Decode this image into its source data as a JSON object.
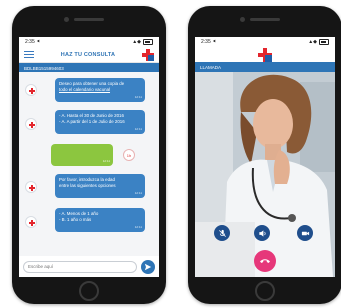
{
  "colors": {
    "brand_blue": "#2e75b6",
    "brand_red": "#e3262d",
    "bubble_blue": "#3b82c4",
    "bubble_green": "#8cc63f",
    "hangup_pink": "#e6377a"
  },
  "left_phone": {
    "status": {
      "time": "2:35 ⯇",
      "signal": "▲◆"
    },
    "header": {
      "title": "HAZ TU CONSULTA"
    },
    "subbar": {
      "id": "BDLBB1515994603"
    },
    "messages": [
      {
        "lines": [
          "Deseo para obtener una copia de",
          "todo el calendario vacunal"
        ],
        "time": "12:11"
      },
      {
        "lines": [
          "- A. Hasta el 30 de Junio de 2016",
          "- A. A partir del 1 de Julio de 2016"
        ],
        "time": "12:11"
      },
      {
        "lines": [
          ""
        ],
        "time": "12:11",
        "badge": "1h"
      },
      {
        "lines": [
          "Por favor, introduzca la edad",
          "entre las siguientes opciones"
        ],
        "time": "12:11"
      },
      {
        "lines": [
          "- A. Menos de 1 año",
          "- B. 1 año o más"
        ],
        "time": "12:11"
      }
    ],
    "input": {
      "placeholder": "Escribe aquí"
    },
    "icons": {
      "menu": "hamburger-icon",
      "send": "send-icon",
      "logo": "cross-logo-icon"
    }
  },
  "right_phone": {
    "status": {
      "time": "2:35 ⯇",
      "signal": "▲◆"
    },
    "subbar": {
      "label": "LLAMADA"
    },
    "icons": {
      "mute": "mic-off-icon",
      "speaker": "speaker-icon",
      "video": "video-camera-icon",
      "hangup": "phone-hangup-icon"
    }
  }
}
